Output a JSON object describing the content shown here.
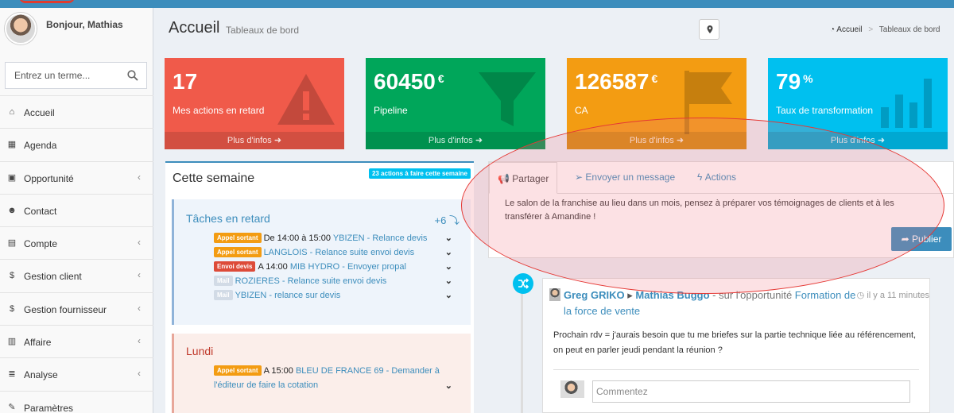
{
  "user": {
    "greeting": "Bonjour, Mathias"
  },
  "search": {
    "placeholder": "Entrez un terme..."
  },
  "sidebar": {
    "items": [
      {
        "label": "Accueil",
        "icon": "home-icon",
        "chevron": false
      },
      {
        "label": "Agenda",
        "icon": "calendar-icon",
        "chevron": false
      },
      {
        "label": "Opportunité",
        "icon": "money-icon",
        "chevron": true
      },
      {
        "label": "Contact",
        "icon": "users-icon",
        "chevron": false
      },
      {
        "label": "Compte",
        "icon": "building-icon",
        "chevron": true
      },
      {
        "label": "Gestion client",
        "icon": "dollar-icon",
        "chevron": true
      },
      {
        "label": "Gestion fournisseur",
        "icon": "dollar-icon",
        "chevron": true
      },
      {
        "label": "Affaire",
        "icon": "briefcase-icon",
        "chevron": true
      },
      {
        "label": "Analyse",
        "icon": "list-icon",
        "chevron": true
      },
      {
        "label": "Paramètres",
        "icon": "wrench-icon",
        "chevron": false
      }
    ]
  },
  "header": {
    "title": "Accueil",
    "subtitle": "Tableaux de bord",
    "breadcrumb": {
      "home": "Accueil",
      "current": "Tableaux de bord"
    }
  },
  "stats": [
    {
      "value": "17",
      "unit": "",
      "label": "Mes actions en retard",
      "footer": "Plus d'infos",
      "color": "#f05a4a"
    },
    {
      "value": "60450",
      "unit": "€",
      "label": "Pipeline",
      "footer": "Plus d'infos",
      "color": "#00a65a"
    },
    {
      "value": "126587",
      "unit": "€",
      "label": "CA",
      "footer": "Plus d'infos",
      "color": "#f39c12"
    },
    {
      "value": "79",
      "unit": "%",
      "label": "Taux de transformation",
      "footer": "Plus d'infos",
      "color": "#00c0ef"
    }
  ],
  "week": {
    "title": "Cette semaine",
    "badge": "23 actions à faire cette semaine",
    "late": {
      "title": "Tâches en retard",
      "more": "+6",
      "tasks": [
        {
          "tag": "Appel sortant",
          "tag_color": "orange",
          "when": "De 14:00 à 15:00",
          "text": "YBIZEN - Relance devis"
        },
        {
          "tag": "Appel sortant",
          "tag_color": "orange",
          "when": "",
          "text": "LANGLOIS - Relance suite envoi devis"
        },
        {
          "tag": "Envoi devis",
          "tag_color": "red",
          "when": "A 14:00",
          "text": "MIB HYDRO - Envoyer propal"
        },
        {
          "tag": "Mail",
          "tag_color": "grey",
          "when": "",
          "text": "ROZIERES - Relance suite envoi devis"
        },
        {
          "tag": "Mail",
          "tag_color": "grey",
          "when": "",
          "text": "YBIZEN - relance sur devis"
        }
      ]
    },
    "monday": {
      "title": "Lundi",
      "task": {
        "tag": "Appel sortant",
        "when": "A 15:00",
        "text_line1": "BLEU DE FRANCE 69 - Demander à",
        "text_line2": "l'éditeur de faire la cotation"
      }
    }
  },
  "share": {
    "tabs": [
      "Partager",
      "Envoyer un message",
      "Actions"
    ],
    "text": "Le salon de la franchise au lieu dans un mois, pensez à préparer vos témoignages de clients et à les transférer à Amandine !",
    "publish_label": "Publier"
  },
  "feed": {
    "author": "Greg GRIKO",
    "target": "Mathias Buggo",
    "mid_text": " - sur l'opportunité ",
    "opportunity": "Formation de la force de vente",
    "time": "il y a 11 minutes",
    "body": "Prochain rdv = j'aurais besoin que tu me briefes sur la partie technique liée au référencement, on peut en parler jeudi pendant la réunion ?",
    "comment_placeholder": "Commentez"
  },
  "colors": {
    "accent": "#3c8dbc",
    "highlight": "#e53935"
  }
}
